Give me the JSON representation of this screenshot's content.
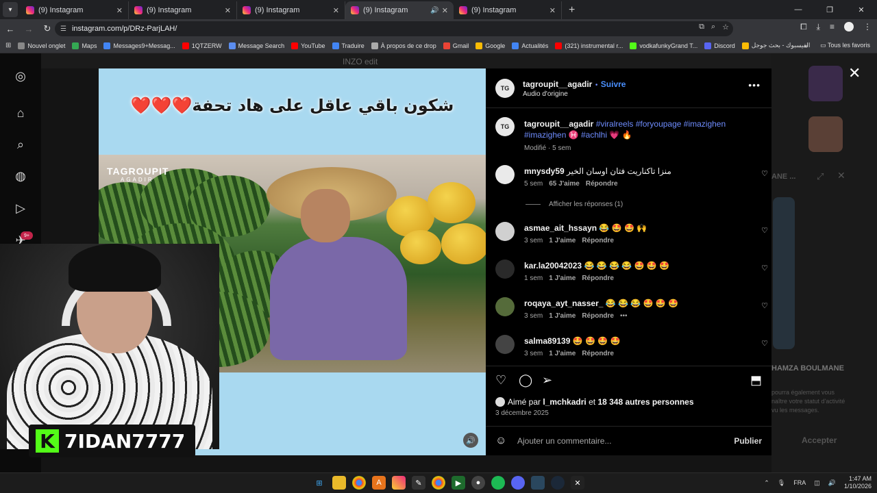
{
  "browser": {
    "tabs": [
      {
        "title": "(9) Instagram",
        "active": false,
        "audio": false
      },
      {
        "title": "(9) Instagram",
        "active": false,
        "audio": false
      },
      {
        "title": "(9) Instagram",
        "active": false,
        "audio": false
      },
      {
        "title": "(9) Instagram",
        "active": true,
        "audio": true
      },
      {
        "title": "(9) Instagram",
        "active": false,
        "audio": false
      }
    ],
    "url": "instagram.com/p/DRz-ParjLAH/",
    "bookmarks": [
      {
        "label": "Nouvel onglet",
        "color": "#888888"
      },
      {
        "label": "Maps",
        "color": "#34a853"
      },
      {
        "label": "Messages9+Messag...",
        "color": "#4285f4"
      },
      {
        "label": "1QTZERW",
        "color": "#ff0000"
      },
      {
        "label": "Message Search",
        "color": "#5b8def"
      },
      {
        "label": "YouTube",
        "color": "#ff0000"
      },
      {
        "label": "Traduire",
        "color": "#4285f4"
      },
      {
        "label": "À propos de ce drop",
        "color": "#aaaaaa"
      },
      {
        "label": "Gmail",
        "color": "#ea4335"
      },
      {
        "label": "Google",
        "color": "#fbbc05"
      },
      {
        "label": "Actualités",
        "color": "#4285f4"
      },
      {
        "label": "(321) instrumental r...",
        "color": "#ff0000"
      },
      {
        "label": "vodkafunkyGrand T...",
        "color": "#53fc18"
      },
      {
        "label": "Discord",
        "color": "#5865f2"
      },
      {
        "label": "الفيسبوك - بحث جوجل",
        "color": "#fbbc05"
      }
    ],
    "all_bookmarks": "Tous les favoris"
  },
  "background": {
    "top_label": "INZO edit"
  },
  "post": {
    "media_caption": "شكون باقي عاقل على هاد تحفة❤️❤️❤️",
    "watermark": "TAGROUPIT",
    "watermark_sub": "AGADIR",
    "author": "tagroupit__agadir",
    "dot": "•",
    "follow": "Suivre",
    "audio": "Audio d'origine",
    "caption_hashtags_1": "#viralreels #foryoupage #imazighen",
    "caption_hashtags_2": "#imazighen ♓ #achlhi",
    "caption_emoji": "💗 🔥",
    "edited": "Modifié · 5 sem",
    "comments": [
      {
        "user": "mnysdy59",
        "text": "منزا تاكناريت فتان اوسان الخير",
        "time": "5 sem",
        "likes": "65 J'aime",
        "reply": "Répondre"
      },
      {
        "user": "asmae_ait_hssayn",
        "text": "😂 🤩 🤩 🙌",
        "time": "3 sem",
        "likes": "1 J'aime",
        "reply": "Répondre"
      },
      {
        "user": "kar.la20042023",
        "text": "😂 😂 😂 😂 🤩 🤩 🤩",
        "time": "1 sem",
        "likes": "1 J'aime",
        "reply": "Répondre"
      },
      {
        "user": "roqaya_ayt_nasser_",
        "text": "😂 😂 😂 🤩 🤩 🤩",
        "time": "3 sem",
        "likes": "1 J'aime",
        "reply": "Répondre"
      },
      {
        "user": "salma89139",
        "text": "🤩 🤩 🤩 🤩",
        "time": "3 sem",
        "likes": "1 J'aime",
        "reply": "Répondre"
      }
    ],
    "view_replies": "Afficher les réponses (1)",
    "liked_by_prefix": "Aimé par",
    "liked_by_user": "l_mchkadri",
    "liked_by_suffix": "et",
    "liked_by_others": "18 348 autres personnes",
    "date": "3 décembre 2025",
    "add_comment_placeholder": "Ajouter un commentaire...",
    "publish": "Publier"
  },
  "ghost_right": {
    "name": "HAMZA BOULMANE",
    "line1": "pourra également vous",
    "line2": "naître votre statut d'activité",
    "line3": "vu les messages.",
    "accept": "Accepter",
    "ane": "ANE ..."
  },
  "streamer": {
    "kick_letter": "K",
    "name": "7IDAN7777"
  },
  "sidebar": {
    "badge": "9+"
  },
  "taskbar": {
    "lang": "FRA",
    "time": "1:47 AM",
    "date": "1/10/2026"
  }
}
